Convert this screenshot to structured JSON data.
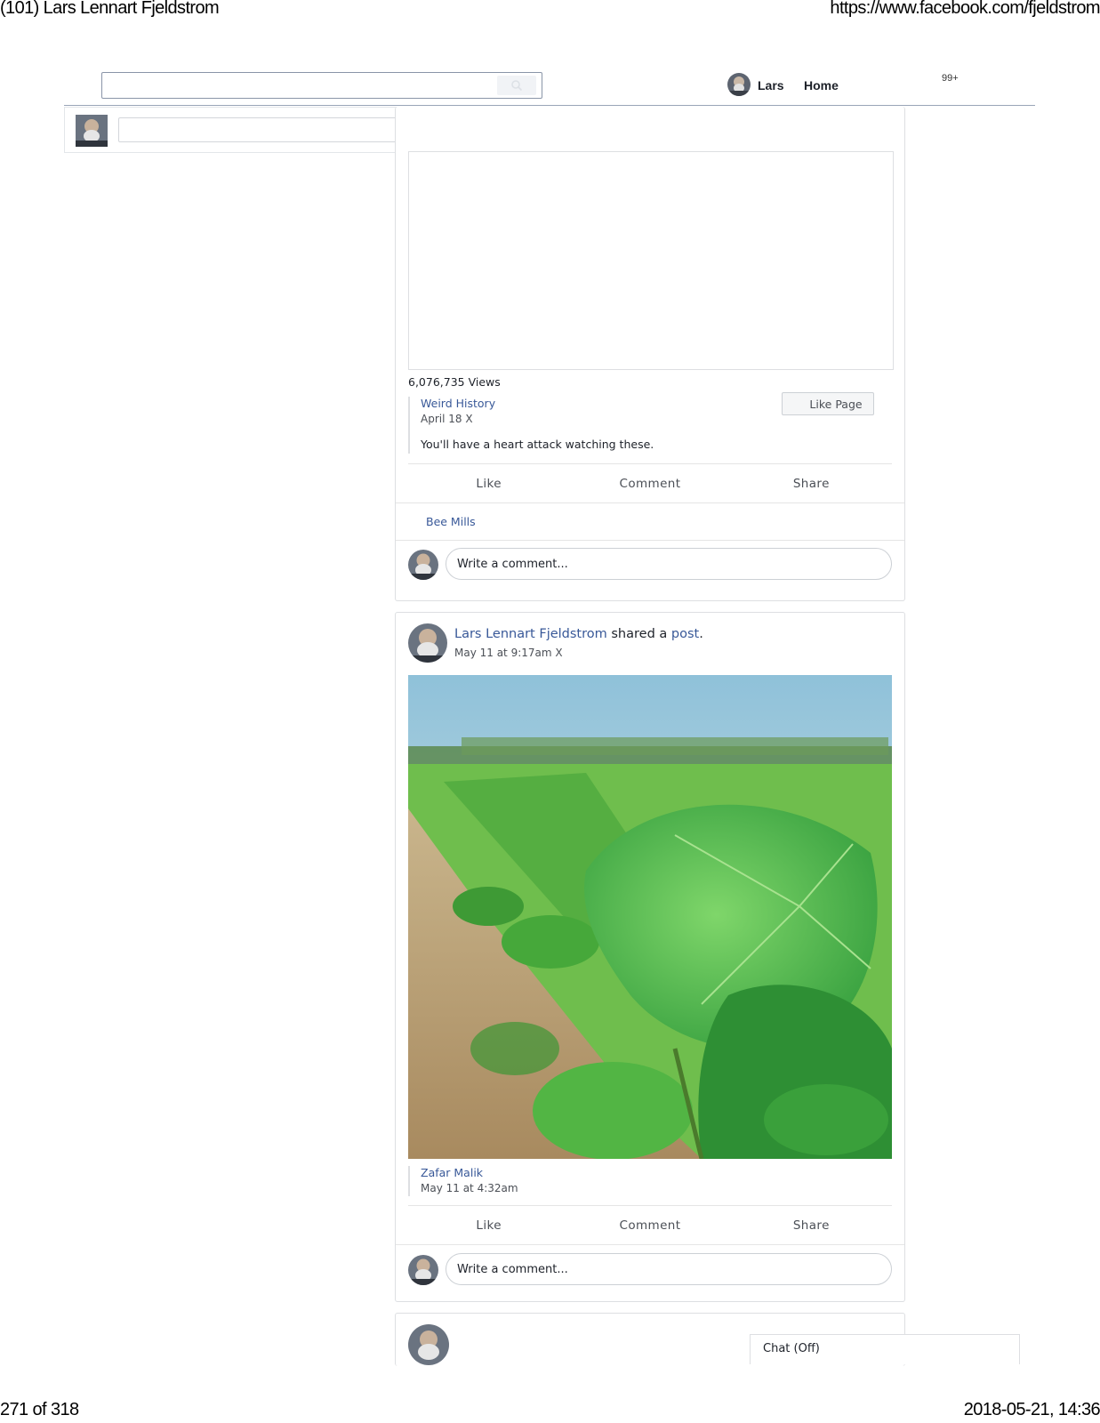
{
  "print_header": {
    "page_title": "(101) Lars Lennart Fjeldstrom",
    "url": "https://www.facebook.com/fjeldstrom"
  },
  "print_footer": {
    "page_count": "271 of 318",
    "datetime": "2018-05-21, 14:36"
  },
  "topnav": {
    "user_name": "Lars",
    "home_label": "Home",
    "notifications_badge": "99+",
    "search_icon": "search-icon"
  },
  "post1": {
    "views": "6,076,735 Views",
    "page_name": "Weird History",
    "date": "April 18",
    "date_suffix": " X",
    "like_page_label": "Like Page",
    "description": "You'll have a heart attack watching these.",
    "actions": {
      "like": "Like",
      "comment": "Comment",
      "share": "Share"
    },
    "commenter_name": "Bee Mills",
    "comment_placeholder": "Write a comment..."
  },
  "post2": {
    "author": "Lars Lennart Fjeldstrom",
    "verb": " shared a ",
    "object_link": "post",
    "period": ".",
    "time": "May 11 at 9:17am",
    "time_suffix": " X",
    "original_author": "Zafar Malik",
    "original_time": "May 11 at 4:32am",
    "actions": {
      "like": "Like",
      "comment": "Comment",
      "share": "Share"
    },
    "comment_placeholder": "Write a comment..."
  },
  "chat": {
    "label": "Chat (Off)"
  },
  "colors": {
    "link": "#385898",
    "border": "#dddfe2",
    "text": "#1d2129",
    "secondary_text": "#4b4f56"
  }
}
